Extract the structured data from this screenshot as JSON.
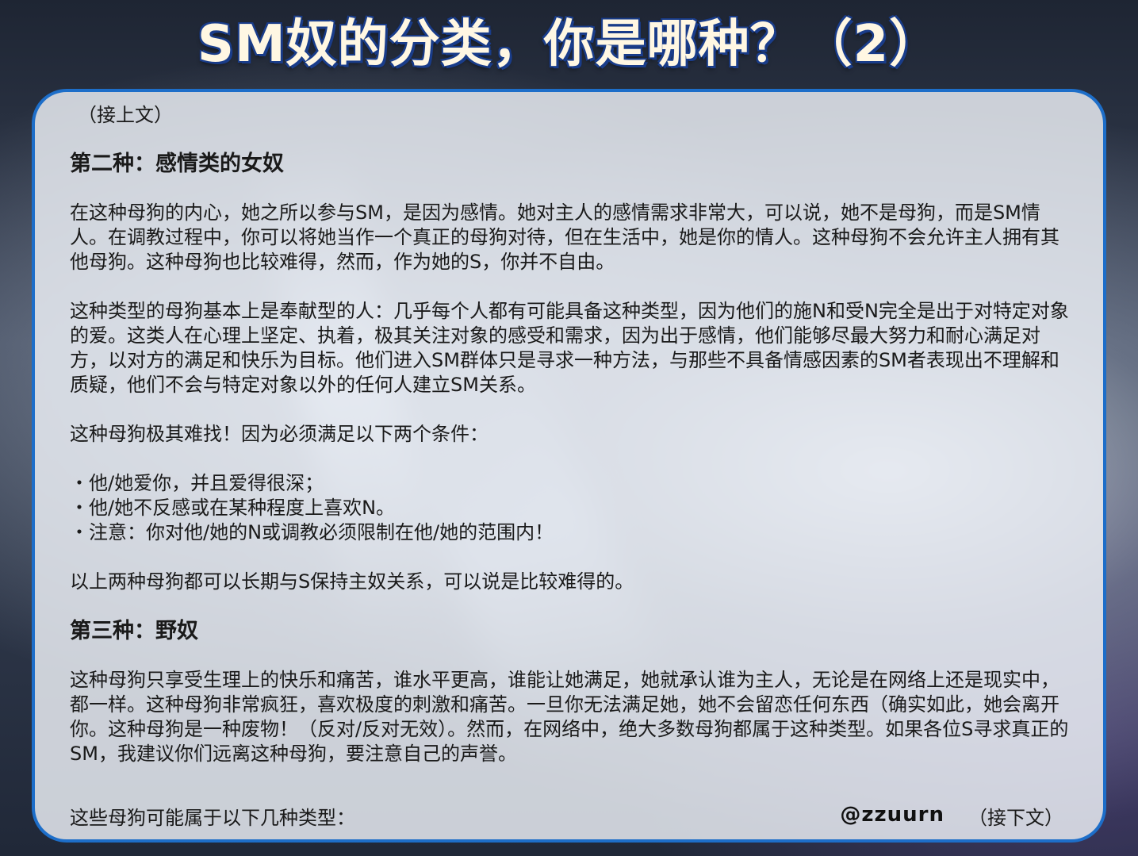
{
  "title": "SM奴的分类，你是哪种？（2）",
  "intro": "（接上文）",
  "section2": {
    "heading": "第二种：感情类的女奴",
    "para1": "在这种母狗的内心，她之所以参与SM，是因为感情。她对主人的感情需求非常大，可以说，她不是母狗，而是SM情人。在调教过程中，你可以将她当作一个真正的母狗对待，但在生活中，她是你的情人。这种母狗不会允许主人拥有其他母狗。这种母狗也比较难得，然而，作为她的S，你并不自由。",
    "para2": "这种类型的母狗基本上是奉献型的人：几乎每个人都有可能具备这种类型，因为他们的施N和受N完全是出于对特定对象的爱。这类人在心理上坚定、执着，极其关注对象的感受和需求，因为出于感情，他们能够尽最大努力和耐心满足对方，以对方的满足和快乐为目标。他们进入SM群体只是寻求一种方法，与那些不具备情感因素的SM者表现出不理解和质疑，他们不会与特定对象以外的任何人建立SM关系。",
    "para3": "这种母狗极其难找！因为必须满足以下两个条件：",
    "bullets": [
      "・他/她爱你，并且爱得很深；",
      "・他/她不反感或在某种程度上喜欢N。",
      "・注意：你对他/她的N或调教必须限制在他/她的范围内！"
    ],
    "summary": "以上两种母狗都可以长期与S保持主奴关系，可以说是比较难得的。"
  },
  "section3": {
    "heading": "第三种：野奴",
    "para1": "这种母狗只享受生理上的快乐和痛苦，谁水平更高，谁能让她满足，她就承认谁为主人，无论是在网络上还是现实中，都一样。这种母狗非常疯狂，喜欢极度的刺激和痛苦。一旦你无法满足她，她不会留恋任何东西（确实如此，她会离开你。这种母狗是一种废物！（反对/反对无效）。然而，在网络中，绝大多数母狗都属于这种类型。如果各位S寻求真正的SM，我建议你们远离这种母狗，要注意自己的声誉。"
  },
  "footer": {
    "left": "这些母狗可能属于以下几种类型：",
    "watermark": "@zzuurn",
    "right": "（接下文）"
  }
}
